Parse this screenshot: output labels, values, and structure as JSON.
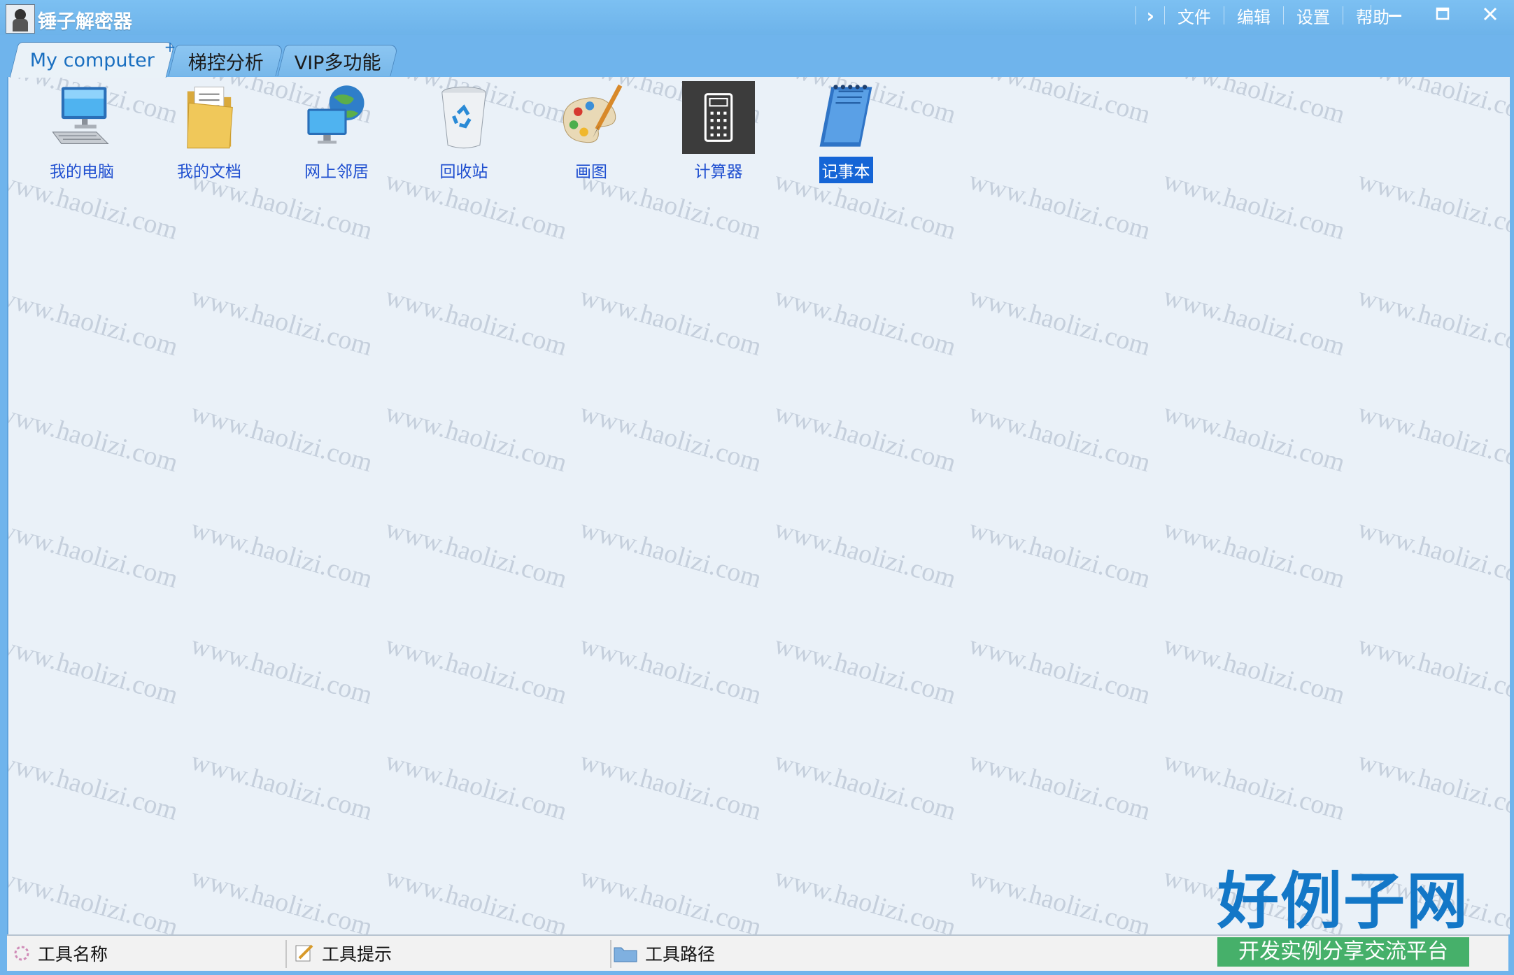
{
  "window": {
    "title": "锤子解密器",
    "menu": [
      "文件",
      "编辑",
      "设置",
      "帮助"
    ],
    "controls": [
      "minimize",
      "maximize",
      "close"
    ]
  },
  "tabs": [
    {
      "label": "My computer",
      "active": true
    },
    {
      "label": "梯控分析",
      "active": false
    },
    {
      "label": "VIP多功能",
      "active": false
    }
  ],
  "desktop": {
    "icons": [
      {
        "label": "我的电脑",
        "icon": "computer-icon"
      },
      {
        "label": "我的文档",
        "icon": "documents-folder-icon"
      },
      {
        "label": "网上邻居",
        "icon": "network-globe-icon"
      },
      {
        "label": "回收站",
        "icon": "recycle-bin-icon"
      },
      {
        "label": "画图",
        "icon": "paint-palette-icon"
      },
      {
        "label": "计算器",
        "icon": "calculator-icon"
      },
      {
        "label": "记事本",
        "icon": "notepad-icon",
        "selected": true
      }
    ]
  },
  "statusbar": {
    "tool_name": "工具名称",
    "tool_hint": "工具提示",
    "tool_path": "工具路径"
  },
  "watermark": "www.haolizi.com",
  "brand": {
    "main": "好例子网",
    "sub": "开发实例分享交流平台"
  },
  "colors": {
    "titlebar": "#6fb4ec",
    "content_bg": "#eaf1f8",
    "icon_label": "#1f4fd0",
    "selection": "#1565d6",
    "brand_blue": "#1377c7",
    "brand_green": "#46b06a"
  }
}
